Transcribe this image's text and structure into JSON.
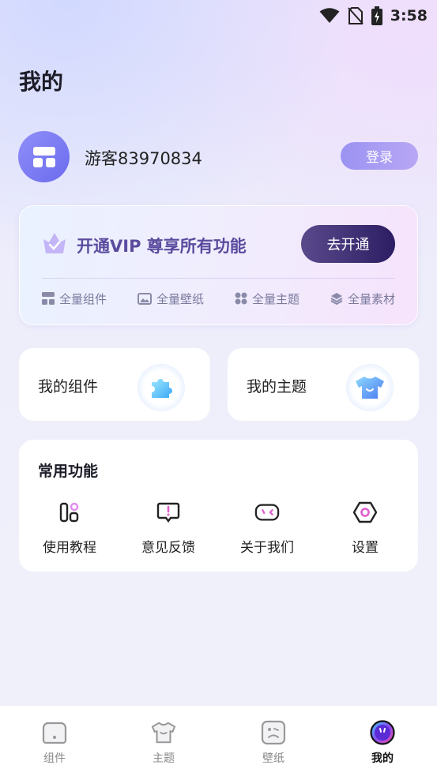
{
  "status_bar": {
    "time": "3:58"
  },
  "page_title": "我的",
  "user": {
    "name": "游客83970834",
    "login_label": "登录"
  },
  "vip": {
    "title": "开通VIP 尊享所有功能",
    "button_label": "去开通",
    "perks": [
      {
        "icon": "widget-grid-icon",
        "label": "全量组件"
      },
      {
        "icon": "image-icon",
        "label": "全量壁纸"
      },
      {
        "icon": "clover-icon",
        "label": "全量主题"
      },
      {
        "icon": "layers-icon",
        "label": "全量素材"
      }
    ]
  },
  "shortcuts": [
    {
      "icon": "puzzle-icon",
      "label": "我的组件"
    },
    {
      "icon": "tshirt-icon",
      "label": "我的主题"
    }
  ],
  "common_functions": {
    "title": "常用功能",
    "items": [
      {
        "icon": "tutorial-icon",
        "label": "使用教程"
      },
      {
        "icon": "feedback-icon",
        "label": "意见反馈"
      },
      {
        "icon": "about-icon",
        "label": "关于我们"
      },
      {
        "icon": "settings-icon",
        "label": "设置"
      }
    ]
  },
  "bottom_nav": {
    "items": [
      {
        "icon": "widget-tab-icon",
        "label": "组件",
        "active": false
      },
      {
        "icon": "theme-tab-icon",
        "label": "主题",
        "active": false
      },
      {
        "icon": "wallpaper-tab-icon",
        "label": "壁纸",
        "active": false
      },
      {
        "icon": "mine-tab-icon",
        "label": "我的",
        "active": true
      }
    ]
  },
  "colors": {
    "accent": "#6b6bef",
    "vip_text": "#5a4b9e",
    "vip_button": "#2c1d63",
    "active_tab": "#111111"
  }
}
